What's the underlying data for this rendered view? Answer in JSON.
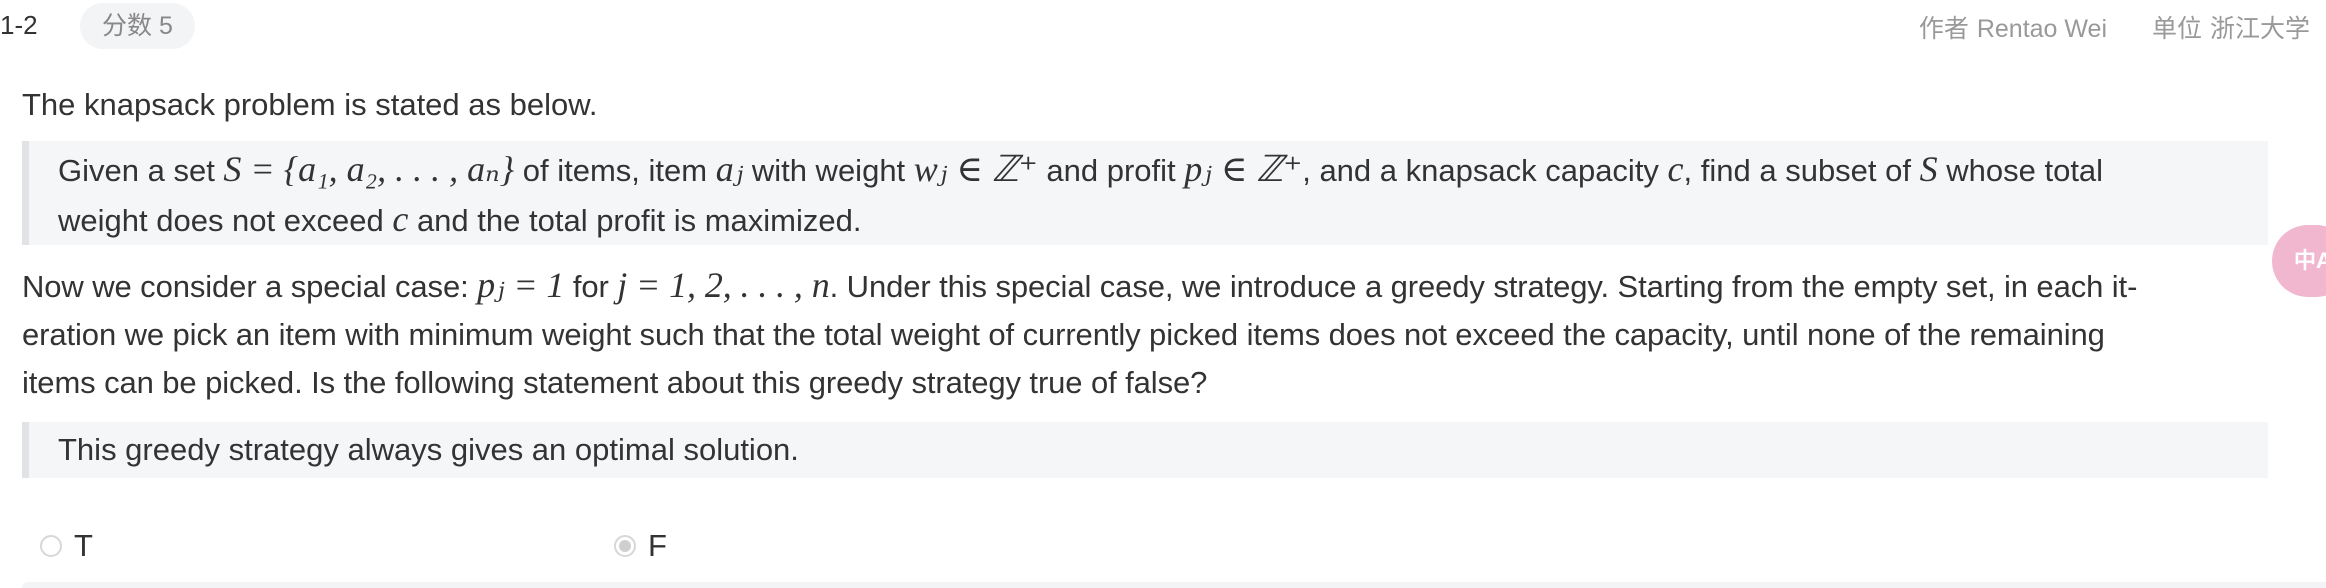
{
  "header": {
    "number": "1-2",
    "score_label": "分数 5",
    "author_label": "作者",
    "author": "Rentao Wei",
    "unit_label": "单位",
    "unit": "浙江大学"
  },
  "intro": "The knapsack problem is stated as below.",
  "definition": {
    "line1": [
      {
        "t": "Given a set "
      },
      {
        "m": "S = {a₁, a₂, . . . , aₙ}"
      },
      {
        "t": " of items, item "
      },
      {
        "m": "aⱼ"
      },
      {
        "t": " with weight "
      },
      {
        "m": "wⱼ ∈ ℤ⁺"
      },
      {
        "t": " and profit "
      },
      {
        "m": "pⱼ ∈ ℤ⁺"
      },
      {
        "t": ", and a knapsack capacity "
      },
      {
        "m": "c"
      },
      {
        "t": ", find a subset of "
      },
      {
        "m": "S"
      },
      {
        "t": " whose total"
      }
    ],
    "line2": [
      {
        "t": "weight does not exceed "
      },
      {
        "m": "c"
      },
      {
        "t": " and the total profit is maximized."
      }
    ]
  },
  "special_case": {
    "line1": [
      {
        "t": "Now we consider a special case: "
      },
      {
        "m": "pⱼ = 1"
      },
      {
        "t": " for "
      },
      {
        "m": "j = 1, 2, . . . , n"
      },
      {
        "t": ". Under this special case, we introduce a greedy strategy. Starting from the empty set, in each it-"
      }
    ],
    "line2": [
      {
        "t": "eration we pick an item with minimum weight such that the total weight of currently picked items does not exceed the capacity, until none of the remaining"
      }
    ],
    "line3": [
      {
        "t": "items can be picked. Is the following statement about this greedy strategy true of false?"
      }
    ]
  },
  "statement": "This greedy strategy always gives an optimal solution.",
  "options": [
    {
      "label": "T",
      "selected": false
    },
    {
      "label": "F",
      "selected": true
    }
  ],
  "translate_icon": "中A"
}
